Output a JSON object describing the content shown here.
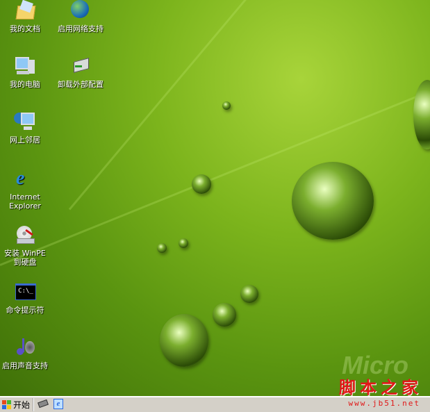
{
  "desktop": {
    "icons": [
      {
        "label": "我的文档",
        "icon": "folder-documents-icon"
      },
      {
        "label": "启用网络支持",
        "icon": "globe-network-icon"
      },
      {
        "label": "我的电脑",
        "icon": "computer-icon"
      },
      {
        "label": "卸载外部配置",
        "icon": "drive-unmount-icon"
      },
      {
        "label": "网上邻居",
        "icon": "network-neighborhood-icon"
      },
      {
        "label": "Internet Explorer",
        "icon": "ie-icon"
      },
      {
        "label": "安装 WinPE 到硬盘",
        "icon": "install-disk-icon"
      },
      {
        "label": "命令提示符",
        "icon": "cmd-icon",
        "glyph": "C:\\_"
      },
      {
        "label": "启用声音支持",
        "icon": "sound-icon"
      }
    ]
  },
  "watermark": {
    "brand": "Micro",
    "site_name": "脚本之家",
    "url": "www.jb51.net"
  },
  "taskbar": {
    "start_label": "开始"
  }
}
